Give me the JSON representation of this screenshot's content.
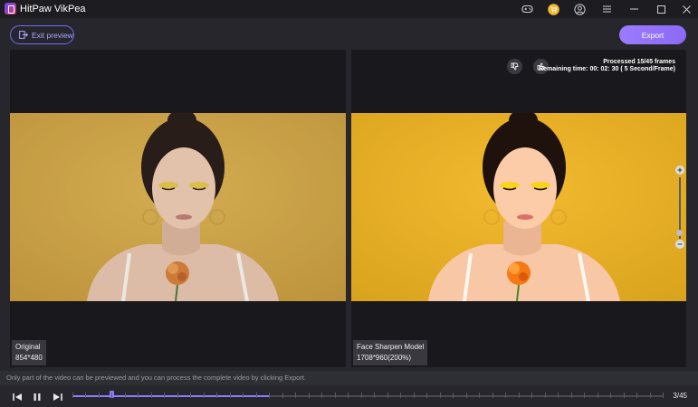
{
  "app": {
    "title": "HitPaw VikPea"
  },
  "toolbar": {
    "exit_label": "Exit preview",
    "export_label": "Export"
  },
  "preview": {
    "original": {
      "label": "Original",
      "resolution": "854*480"
    },
    "enhanced": {
      "label": "Face Sharpen Model",
      "resolution": "1708*960(200%)"
    },
    "status_line1": "Processed 15/45 frames",
    "status_line2": "Remaining time: 00: 02: 30 ( 5 Second/Frame)"
  },
  "notice": "Only part of the video can be previewed and you can process the complete video by clicking Export.",
  "playback": {
    "current_frame": 3,
    "total_frames": 45,
    "frame_label": "3/45",
    "processed_frames": 15
  },
  "icons": {
    "gamepad": "gamepad-icon",
    "cart": "cart-icon",
    "user": "user-icon",
    "menu": "menu-icon",
    "minimize": "minimize-icon",
    "maximize": "maximize-icon",
    "close": "close-icon",
    "thumbs_down": "thumbs-down-icon",
    "thumbs_up": "thumbs-up-icon"
  },
  "colors": {
    "accent": "#8c7cff",
    "cart_badge": "#f5b82e",
    "background": "#26262c"
  }
}
